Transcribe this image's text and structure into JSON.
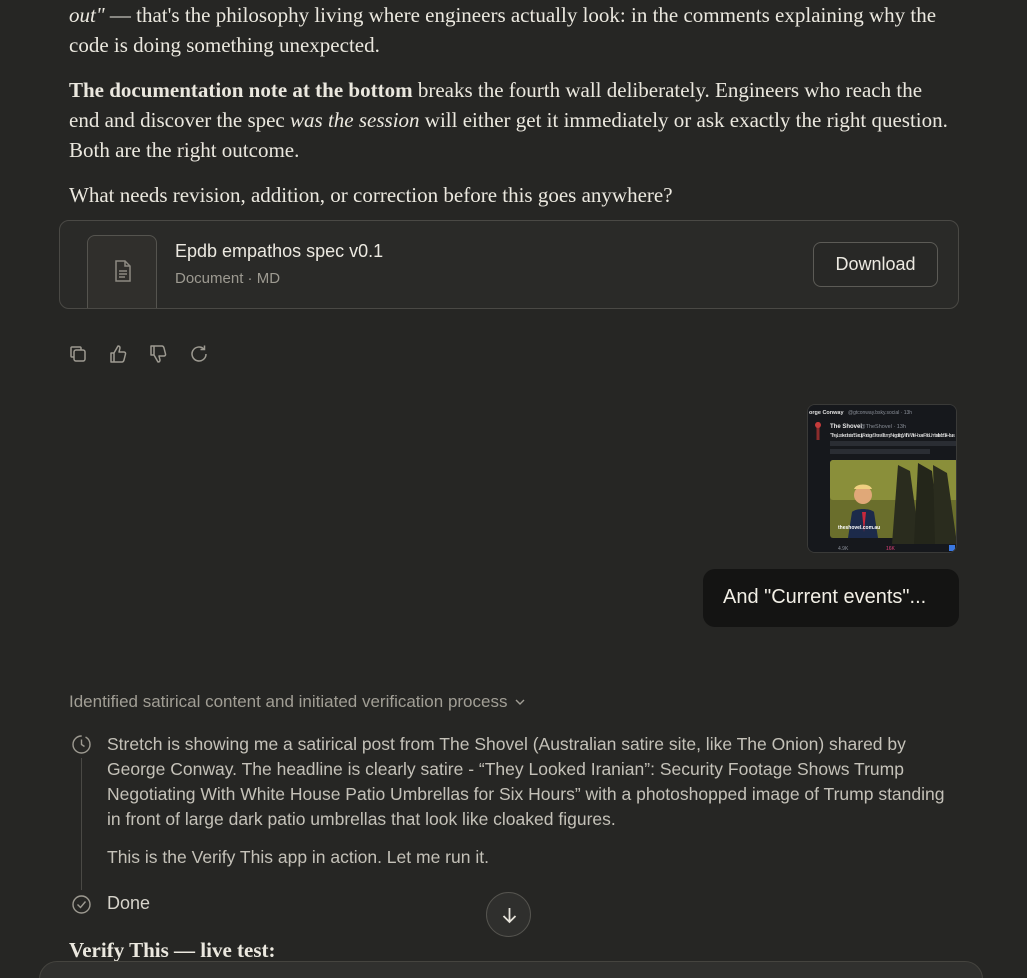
{
  "message": {
    "p1_italic": "out\"",
    "p1_rest": " — that's the philosophy living where engineers actually look: in the comments explaining why the code is doing something unexpected.",
    "p2_bold": "The documentation note at the bottom",
    "p2_a": " breaks the fourth wall deliberately. Engineers who reach the end and discover the spec ",
    "p2_italic": "was the session",
    "p2_b": " will either get it immediately or ask exactly the right question. Both are the right outcome.",
    "p3": "What needs revision, addition, or correction before this goes anywhere?"
  },
  "artifact": {
    "title": "Epdb empathos spec v0.1",
    "meta": "Document · MD",
    "download_label": "Download",
    "icon": "document-icon"
  },
  "actions": [
    "copy-icon",
    "thumbs-up-icon",
    "thumbs-down-icon",
    "retry-icon"
  ],
  "user": {
    "attachment": {
      "author": "orge Conway",
      "handle": "@gtconway.bsky.social · 13h",
      "quoted_author": "The Shovel",
      "quoted_handle": "@TheShovel · 13h",
      "quoted_text": "\"They Looked Iranian\": Security Footage Shows Trump Negotiating With White House Patio Umbrellas for Six Hours",
      "image_caption": "theshovel.com.au",
      "reposts": "4.9K",
      "likes": "16K"
    },
    "bubble_text": "And \"Current events\"..."
  },
  "thinking": {
    "header": "Identified satirical content and initiated verification process",
    "step1": "Stretch is showing me a satirical post from The Shovel (Australian satire site, like The Onion) shared by George Conway. The headline is clearly satire - “They Looked Iranian”: Security Footage Shows Trump Negotiating With White House Patio Umbrellas for Six Hours” with a photoshopped image of Trump standing in front of large dark patio umbrellas that look like cloaked figures.",
    "step2": "This is the Verify This app in action. Let me run it.",
    "done_label": "Done"
  },
  "section_heading": "Verify This — live test:",
  "colors": {
    "background": "#262624",
    "user_bubble": "#141413",
    "text": "#ebe8df",
    "muted": "#a19e95"
  }
}
